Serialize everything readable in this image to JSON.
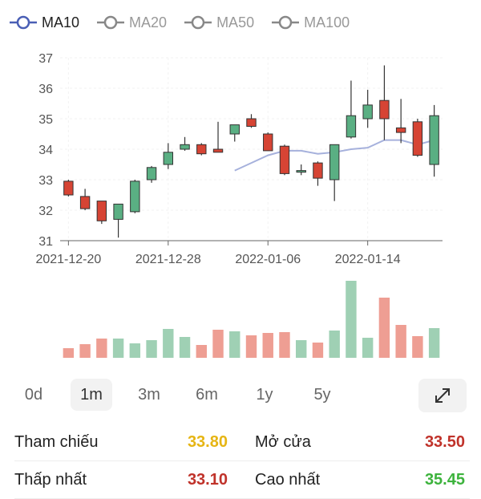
{
  "legend": [
    {
      "label": "MA10",
      "active": true,
      "color": "#4a5fb5"
    },
    {
      "label": "MA20",
      "active": false,
      "color": "#888888"
    },
    {
      "label": "MA50",
      "active": false,
      "color": "#888888"
    },
    {
      "label": "MA100",
      "active": false,
      "color": "#888888"
    }
  ],
  "colors": {
    "up": "#5aaf83",
    "down": "#d64434",
    "ma10": "#a6b1dc",
    "vol_up": "#9fd0b4",
    "vol_down": "#ee9e93",
    "ref": "#e6b514",
    "high": "#3db33d"
  },
  "chart_data": {
    "type": "candlestick",
    "ylim": [
      31,
      37
    ],
    "yticks": [
      "31",
      "32",
      "33",
      "34",
      "35",
      "36",
      "37"
    ],
    "xticks": [
      "2021-12-20",
      "2021-12-28",
      "2022-01-06",
      "2022-01-14"
    ],
    "xtick_index": [
      0,
      6,
      12,
      18
    ],
    "candles": [
      {
        "o": 32.95,
        "h": 33.0,
        "l": 32.45,
        "c": 32.5
      },
      {
        "o": 32.45,
        "h": 32.7,
        "l": 32.0,
        "c": 32.05
      },
      {
        "o": 32.3,
        "h": 32.3,
        "l": 31.55,
        "c": 31.65
      },
      {
        "o": 31.7,
        "h": 32.2,
        "l": 31.1,
        "c": 32.2
      },
      {
        "o": 31.95,
        "h": 33.0,
        "l": 31.9,
        "c": 32.95
      },
      {
        "o": 33.0,
        "h": 33.45,
        "l": 32.9,
        "c": 33.4
      },
      {
        "o": 33.5,
        "h": 34.2,
        "l": 33.35,
        "c": 33.9
      },
      {
        "o": 34.0,
        "h": 34.4,
        "l": 33.95,
        "c": 34.15
      },
      {
        "o": 34.15,
        "h": 34.2,
        "l": 33.8,
        "c": 33.85
      },
      {
        "o": 34.0,
        "h": 34.9,
        "l": 33.9,
        "c": 33.9
      },
      {
        "o": 34.5,
        "h": 34.8,
        "l": 34.25,
        "c": 34.8
      },
      {
        "o": 35.0,
        "h": 35.15,
        "l": 34.7,
        "c": 34.75
      },
      {
        "o": 34.5,
        "h": 34.55,
        "l": 33.95,
        "c": 33.95
      },
      {
        "o": 34.1,
        "h": 34.15,
        "l": 33.15,
        "c": 33.2
      },
      {
        "o": 33.3,
        "h": 33.5,
        "l": 33.15,
        "c": 33.3
      },
      {
        "o": 33.55,
        "h": 33.6,
        "l": 32.8,
        "c": 33.05
      },
      {
        "o": 33.0,
        "h": 34.15,
        "l": 32.3,
        "c": 34.15
      },
      {
        "o": 34.4,
        "h": 36.25,
        "l": 34.35,
        "c": 35.1
      },
      {
        "o": 35.0,
        "h": 35.95,
        "l": 34.7,
        "c": 35.45
      },
      {
        "o": 35.6,
        "h": 36.75,
        "l": 34.3,
        "c": 35.0
      },
      {
        "o": 34.7,
        "h": 35.65,
        "l": 34.2,
        "c": 34.55
      },
      {
        "o": 34.9,
        "h": 35.0,
        "l": 33.75,
        "c": 33.8
      },
      {
        "o": 33.5,
        "h": 35.45,
        "l": 33.1,
        "c": 35.1
      }
    ],
    "ma10": [
      null,
      null,
      null,
      null,
      null,
      null,
      null,
      null,
      null,
      null,
      33.3,
      33.55,
      33.8,
      33.95,
      33.95,
      33.85,
      33.9,
      34.0,
      34.05,
      34.3,
      34.3,
      34.15,
      34.3
    ],
    "volumes": [
      0.12,
      0.17,
      0.24,
      0.24,
      0.18,
      0.22,
      0.36,
      0.26,
      0.16,
      0.35,
      0.33,
      0.28,
      0.31,
      0.32,
      0.22,
      0.19,
      0.34,
      0.96,
      0.25,
      0.75,
      0.41,
      0.27,
      0.37
    ]
  },
  "periods": [
    "0d",
    "1m",
    "3m",
    "6m",
    "1y",
    "5y"
  ],
  "active_period": "1m",
  "stats": {
    "reference_label": "Tham chiếu",
    "reference_value": "33.80",
    "open_label": "Mở cửa",
    "open_value": "33.50",
    "low_label": "Thấp nhất",
    "low_value": "33.10",
    "high_label": "Cao nhất",
    "high_value": "35.45"
  }
}
